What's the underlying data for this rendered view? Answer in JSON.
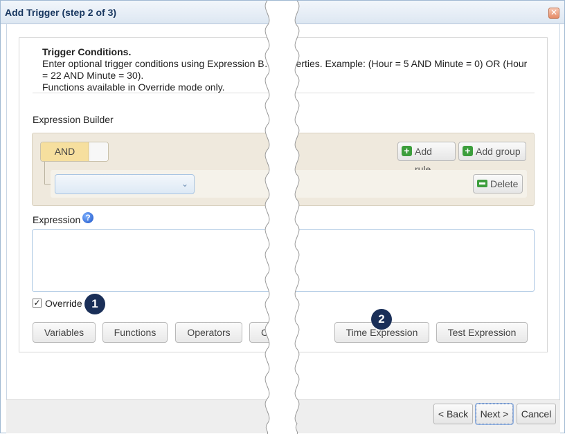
{
  "dialog": {
    "title": "Add Trigger (step 2 of 3)",
    "close_symbol": "✕"
  },
  "conditions": {
    "heading": "Trigger Conditions.",
    "description": "Enter optional trigger conditions using Expression B… properties. Example: (Hour = 5 AND Minute = 0) OR (Hour = 22 AND Minute = 30).",
    "note": "Functions available in Override mode only."
  },
  "builder": {
    "label": "Expression Builder",
    "and_label": "AND",
    "add_rule_label": "Add rule",
    "add_group_label": "Add group",
    "delete_label": "Delete",
    "field_value": ""
  },
  "expression": {
    "label": "Expression",
    "value": ""
  },
  "override": {
    "label": "Override",
    "checked": true
  },
  "badges": [
    "1",
    "2"
  ],
  "tool_buttons": {
    "variables": "Variables",
    "functions": "Functions",
    "operators": "Operators",
    "constants_truncated": "Co",
    "time_expression": "Time Expression",
    "test_expression": "Test Expression"
  },
  "footer": {
    "back": "< Back",
    "next": "Next >",
    "cancel": "Cancel"
  },
  "colors": {
    "title_text": "#17365f",
    "builder_bg": "#efe9dd",
    "and_active": "#f6df9e",
    "badge_bg": "#1a2f58",
    "add_icon": "#3c9e3c"
  },
  "icons": {
    "close": "close-icon",
    "help": "help-icon",
    "add": "plus-icon",
    "delete": "minus-icon",
    "dropdown": "chevron-down-icon",
    "checkbox": "check-icon"
  }
}
